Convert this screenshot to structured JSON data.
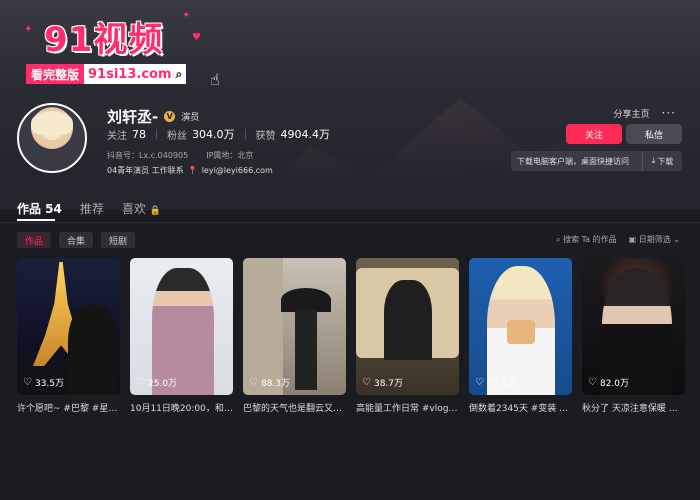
{
  "watermark": {
    "title": "91视频",
    "tag": "看完整版",
    "url": "91si13.com"
  },
  "profile": {
    "name": "刘轩丞-",
    "role": "演员",
    "following_label": "关注",
    "following": "78",
    "fans_label": "粉丝",
    "fans": "304.0万",
    "likes_label": "获赞",
    "likes": "4904.4万",
    "douyin_id": "抖音号：Lx.c.040905",
    "ip_location": "IP属地：北京",
    "bio_line": "04青年演员 工作联系",
    "bio_email": "leyi@leyi666.com"
  },
  "actions": {
    "share": "分享主页",
    "more": "···",
    "follow": "关注",
    "message": "私信",
    "download_text": "下载电脑客户端，桌面快捷访问",
    "download_btn": "下载"
  },
  "tabs": [
    {
      "label": "作品 54",
      "active": true
    },
    {
      "label": "推荐",
      "active": false
    },
    {
      "label": "喜欢",
      "active": false
    }
  ],
  "chips": [
    "作品",
    "合集",
    "短剧"
  ],
  "filters": {
    "search": "搜索 Ta 的作品",
    "date": "日期筛选"
  },
  "videos": [
    {
      "likes": "33.5万",
      "caption": "许个愿吧~ #巴黎 #星光…"
    },
    {
      "likes": "25.0万",
      "caption": "10月11日晚20:00，和…"
    },
    {
      "likes": "88.3万",
      "caption": "巴黎的天气也是翻云又…"
    },
    {
      "likes": "38.7万",
      "caption": "高能量工作日常 #vlog #…"
    },
    {
      "likes": "75.1万",
      "caption": "倒数着2345天 #变装 #…"
    },
    {
      "likes": "82.0万",
      "caption": "秋分了 天凉注意保暖 #…"
    }
  ],
  "colors": {
    "accent": "#fe2c55",
    "background": "#1b1b22",
    "watermark": "#ff2d6c"
  }
}
